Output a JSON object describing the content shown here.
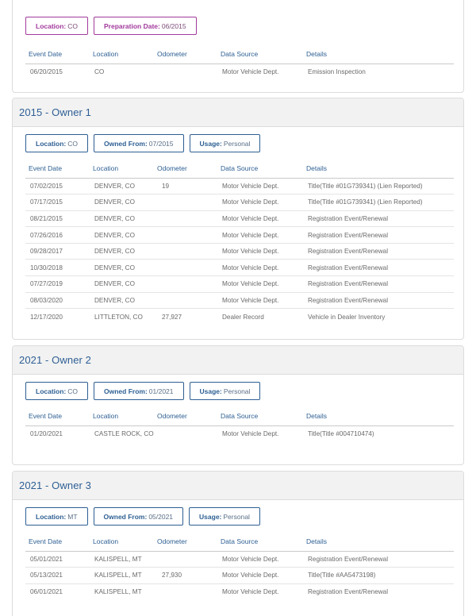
{
  "columns": [
    "Event Date",
    "Location",
    "Odometer",
    "Data Source",
    "Details"
  ],
  "top_section": {
    "tags": [
      {
        "label": "Location:",
        "value": "CO"
      },
      {
        "label": "Preparation Date:",
        "value": "06/2015"
      }
    ],
    "rows": [
      {
        "date": "06/20/2015",
        "location": "CO",
        "odometer": "",
        "source": "Motor Vehicle Dept.",
        "details": "Emission Inspection"
      }
    ]
  },
  "owners": [
    {
      "title": "2015 - Owner  1",
      "tags": [
        {
          "label": "Location:",
          "value": "CO"
        },
        {
          "label": "Owned From:",
          "value": "07/2015"
        },
        {
          "label": "Usage:",
          "value": "Personal"
        }
      ],
      "rows": [
        {
          "date": "07/02/2015",
          "location": "DENVER, CO",
          "odometer": "19",
          "source": "Motor Vehicle Dept.",
          "details": "Title(Title #01G739341) (Lien Reported)"
        },
        {
          "date": "07/17/2015",
          "location": "DENVER, CO",
          "odometer": "",
          "source": "Motor Vehicle Dept.",
          "details": "Title(Title #01G739341) (Lien Reported)"
        },
        {
          "date": "08/21/2015",
          "location": "DENVER, CO",
          "odometer": "",
          "source": "Motor Vehicle Dept.",
          "details": "Registration Event/Renewal"
        },
        {
          "date": "07/26/2016",
          "location": "DENVER, CO",
          "odometer": "",
          "source": "Motor Vehicle Dept.",
          "details": "Registration Event/Renewal"
        },
        {
          "date": "09/28/2017",
          "location": "DENVER, CO",
          "odometer": "",
          "source": "Motor Vehicle Dept.",
          "details": "Registration Event/Renewal"
        },
        {
          "date": "10/30/2018",
          "location": "DENVER, CO",
          "odometer": "",
          "source": "Motor Vehicle Dept.",
          "details": "Registration Event/Renewal"
        },
        {
          "date": "07/27/2019",
          "location": "DENVER, CO",
          "odometer": "",
          "source": "Motor Vehicle Dept.",
          "details": "Registration Event/Renewal"
        },
        {
          "date": "08/03/2020",
          "location": "DENVER, CO",
          "odometer": "",
          "source": "Motor Vehicle Dept.",
          "details": "Registration Event/Renewal"
        },
        {
          "date": "12/17/2020",
          "location": "LITTLETON, CO",
          "odometer": "27,927",
          "source": "Dealer Record",
          "details": "Vehicle in Dealer Inventory"
        }
      ]
    },
    {
      "title": "2021 - Owner  2",
      "tags": [
        {
          "label": "Location:",
          "value": "CO"
        },
        {
          "label": "Owned From:",
          "value": "01/2021"
        },
        {
          "label": "Usage:",
          "value": "Personal"
        }
      ],
      "rows": [
        {
          "date": "01/20/2021",
          "location": "CASTLE ROCK, CO",
          "odometer": "",
          "source": "Motor Vehicle Dept.",
          "details": "Title(Title #004710474)"
        }
      ]
    },
    {
      "title": "2021 - Owner  3",
      "tags": [
        {
          "label": "Location:",
          "value": "MT"
        },
        {
          "label": "Owned From:",
          "value": "05/2021"
        },
        {
          "label": "Usage:",
          "value": "Personal"
        }
      ],
      "rows": [
        {
          "date": "05/01/2021",
          "location": "KALISPELL, MT",
          "odometer": "",
          "source": "Motor Vehicle Dept.",
          "details": "Registration Event/Renewal"
        },
        {
          "date": "05/13/2021",
          "location": "KALISPELL, MT",
          "odometer": "27,930",
          "source": "Motor Vehicle Dept.",
          "details": "Title(Title #AA5473198)"
        },
        {
          "date": "06/01/2021",
          "location": "KALISPELL, MT",
          "odometer": "",
          "source": "Motor Vehicle Dept.",
          "details": "Registration Event/Renewal"
        }
      ]
    }
  ]
}
